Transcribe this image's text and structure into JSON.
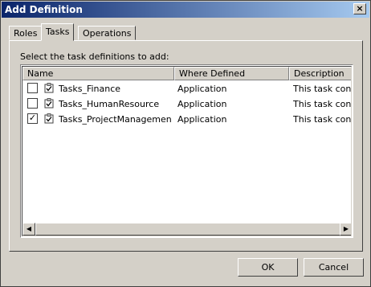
{
  "window": {
    "title": "Add Definition",
    "close_glyph": "×"
  },
  "tabs": [
    {
      "label": "Roles"
    },
    {
      "label": "Tasks"
    },
    {
      "label": "Operations"
    }
  ],
  "prompt": "Select the task definitions to add:",
  "columns": [
    "Name",
    "Where Defined",
    "Description"
  ],
  "rows": [
    {
      "checked": false,
      "name": "Tasks_Finance",
      "where": "Application",
      "description": "This task conta"
    },
    {
      "checked": false,
      "name": "Tasks_HumanResource",
      "where": "Application",
      "description": "This task conta"
    },
    {
      "checked": true,
      "name": "Tasks_ProjectManagement",
      "where": "Application",
      "description": "This task conta"
    }
  ],
  "icons": {
    "check_glyph": "✓",
    "task": "task-checklist-icon",
    "scroll_left": "◀",
    "scroll_right": "▶"
  },
  "buttons": {
    "ok": "OK",
    "cancel": "Cancel"
  }
}
